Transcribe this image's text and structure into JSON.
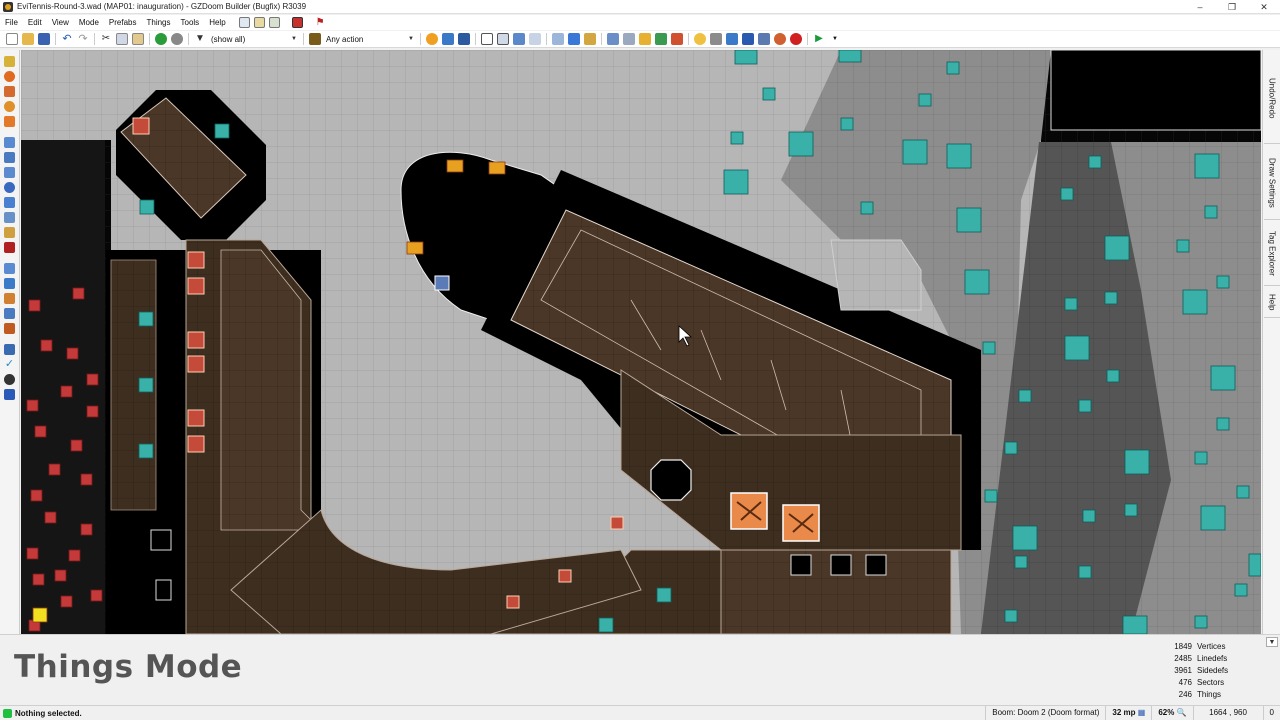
{
  "window": {
    "title": "EviTennis-Round-3.wad (MAP01: inauguration) - GZDoom Builder (Bugfix) R3039",
    "controls": [
      "–",
      "❐",
      "✕"
    ]
  },
  "menu": {
    "items": [
      "File",
      "Edit",
      "View",
      "Mode",
      "Prefabs",
      "Things",
      "Tools",
      "Help"
    ]
  },
  "toolbar": {
    "filter_value": "(show all)",
    "action_value": "Any action"
  },
  "dock": {
    "tabs": [
      "Undo/Redo",
      "Draw Settings",
      "Tag Explorer",
      "Help"
    ]
  },
  "info": {
    "mode_label": "Things Mode",
    "stats": [
      {
        "value": "1849",
        "label": "Vertices"
      },
      {
        "value": "2485",
        "label": "Linedefs"
      },
      {
        "value": "3961",
        "label": "Sidedefs"
      },
      {
        "value": "476",
        "label": "Sectors"
      },
      {
        "value": "246",
        "label": "Things"
      }
    ]
  },
  "status": {
    "message": "Nothing selected.",
    "config": "Boom: Doom 2 (Doom format)",
    "grid": "32 mp",
    "zoom": "62%",
    "coords": "1664 , 960",
    "selection_count": "0"
  },
  "colors": {
    "floor_brown": "#3d2d1f",
    "floor_gray": "#9a9a9a",
    "outdoor_light": "#b4b4b4",
    "thing_red": "#c43a3a",
    "thing_teal": "#39b0a8",
    "selection_orange": "#e98a4a",
    "status_green": "#1fbf3f"
  }
}
